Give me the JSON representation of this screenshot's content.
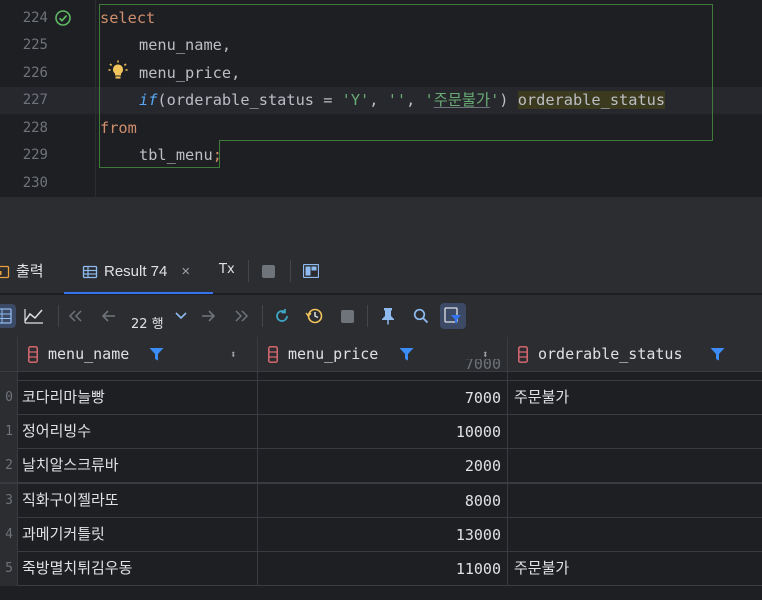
{
  "editor": {
    "line_numbers": [
      "224",
      "225",
      "226",
      "227",
      "228",
      "229",
      "230"
    ],
    "lines": {
      "l224": {
        "kw": "select"
      },
      "l225": {
        "ident": "menu_name",
        "punct": ","
      },
      "l226": {
        "ident": "menu_price",
        "punct": ","
      },
      "l227": {
        "fn": "if",
        "open": "(",
        "col": "orderable_status",
        "op": " = ",
        "s1": "'Y'",
        "c1": ", ",
        "s2": "''",
        "c2": ", ",
        "s3a": "'",
        "s3b": "주문불가",
        "s3c": "'",
        "close": ")",
        "alias": "orderable_status"
      },
      "l228": {
        "kw": "from"
      },
      "l229": {
        "ident": "tbl_menu",
        "punct": ";"
      }
    }
  },
  "tool_window": {
    "tabs": [
      {
        "label": "출력",
        "icon": "output-icon"
      },
      {
        "label": "Result 74",
        "icon": "table-icon",
        "close": "×"
      }
    ],
    "tx_label": "Tx"
  },
  "toolbar": {
    "rows_label": "22 행",
    "icons": [
      "grid-view-icon",
      "chart-icon",
      "first-page-icon",
      "prev-page-icon",
      "chevron-down-icon",
      "next-page-icon",
      "last-page-icon",
      "refresh-icon",
      "history-icon",
      "stop-icon",
      "pin-icon",
      "search-icon",
      "filter-view-icon"
    ]
  },
  "grid": {
    "columns": [
      {
        "name": "menu_name"
      },
      {
        "name": "menu_price"
      },
      {
        "name": "orderable_status"
      }
    ],
    "rows": [
      {
        "idx": "",
        "name": "",
        "price": "7000",
        "status": ""
      },
      {
        "idx": "0",
        "name": "코다리마늘빵",
        "price": "7000",
        "status": "주문불가"
      },
      {
        "idx": "1",
        "name": "정어리빙수",
        "price": "10000",
        "status": ""
      },
      {
        "idx": "2",
        "name": "날치알스크류바",
        "price": "2000",
        "status": ""
      },
      {
        "idx": "3",
        "name": "직화구이젤라또",
        "price": "8000",
        "status": ""
      },
      {
        "idx": "4",
        "name": "과메기커틀릿",
        "price": "13000",
        "status": ""
      },
      {
        "idx": "5",
        "name": "죽방멸치튀김우동",
        "price": "11000",
        "status": "주문불가"
      }
    ]
  },
  "colors": {
    "accent": "#3574f0",
    "keyword": "#cf8e6d",
    "string": "#6aab73",
    "function": "#56a8f5",
    "column_icon": "#e06c75"
  }
}
